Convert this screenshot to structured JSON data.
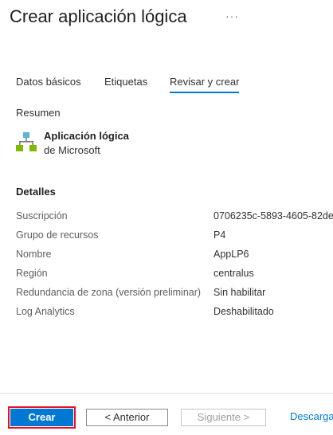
{
  "header": {
    "title": "Crear aplicación lógica",
    "more_label": "···"
  },
  "tabs": [
    {
      "label": "Datos básicos",
      "active": false
    },
    {
      "label": "Etiquetas",
      "active": false
    },
    {
      "label": "Revisar y crear",
      "active": true
    }
  ],
  "summary": {
    "heading": "Resumen",
    "icon": "logic-app-icon",
    "title": "Aplicación lógica",
    "subtitle": "de Microsoft"
  },
  "details": {
    "heading": "Detalles",
    "rows": [
      {
        "label": "Suscripción",
        "value": "0706235c-5893-4605-82de"
      },
      {
        "label": "Grupo de recursos",
        "value": "P4"
      },
      {
        "label": "Nombre",
        "value": "AppLP6"
      },
      {
        "label": "Región",
        "value": "centralus"
      },
      {
        "label": "Redundancia de zona (versión preliminar)",
        "value": "Sin habilitar"
      },
      {
        "label": "Log Analytics",
        "value": "Deshabilitado"
      }
    ]
  },
  "footer": {
    "create_label": "Crear",
    "previous_label": "< Anterior",
    "next_label": "Siguiente >",
    "download_label": "Descargar"
  },
  "colors": {
    "accent": "#0078d4",
    "highlight_border": "#e81123"
  }
}
